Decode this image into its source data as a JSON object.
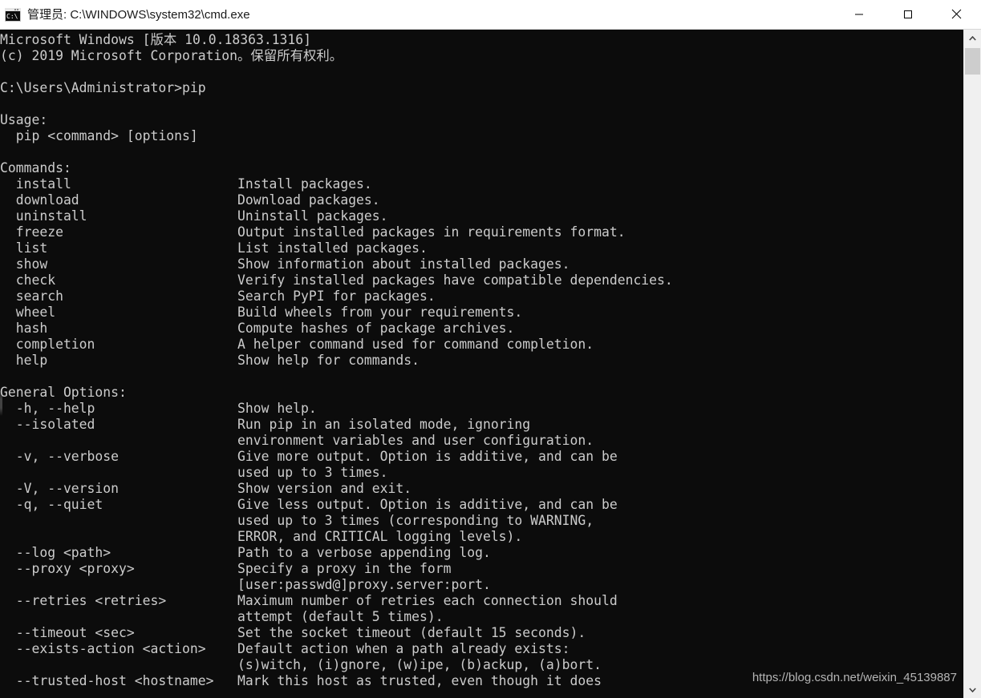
{
  "window": {
    "title": "管理员: C:\\WINDOWS\\system32\\cmd.exe",
    "icon": "cmd-icon",
    "controls": {
      "minimize": "minimize-button",
      "maximize": "maximize-button",
      "close": "close-button"
    },
    "colors": {
      "titlebar_bg": "#ffffff",
      "titlebar_fg": "#1a1a1a",
      "console_bg": "#0c0c0c",
      "console_fg": "#cccccc",
      "scrollbar_track": "#f0f0f0",
      "scrollbar_thumb": "#cdcdcd"
    }
  },
  "console": {
    "banner": [
      "Microsoft Windows [版本 10.0.18363.1316]",
      "(c) 2019 Microsoft Corporation。保留所有权利。"
    ],
    "prompt": "C:\\Users\\Administrator>",
    "command": "pip",
    "usage_header": "Usage:",
    "usage_line": "pip <command> [options]",
    "commands_header": "Commands:",
    "commands": [
      {
        "name": "install",
        "desc": "Install packages."
      },
      {
        "name": "download",
        "desc": "Download packages."
      },
      {
        "name": "uninstall",
        "desc": "Uninstall packages."
      },
      {
        "name": "freeze",
        "desc": "Output installed packages in requirements format."
      },
      {
        "name": "list",
        "desc": "List installed packages."
      },
      {
        "name": "show",
        "desc": "Show information about installed packages."
      },
      {
        "name": "check",
        "desc": "Verify installed packages have compatible dependencies."
      },
      {
        "name": "search",
        "desc": "Search PyPI for packages."
      },
      {
        "name": "wheel",
        "desc": "Build wheels from your requirements."
      },
      {
        "name": "hash",
        "desc": "Compute hashes of package archives."
      },
      {
        "name": "completion",
        "desc": "A helper command used for command completion."
      },
      {
        "name": "help",
        "desc": "Show help for commands."
      }
    ],
    "general_options_header": "General Options:",
    "general_options": [
      {
        "name": "-h, --help",
        "desc": [
          "Show help."
        ]
      },
      {
        "name": "--isolated",
        "desc": [
          "Run pip in an isolated mode, ignoring",
          "environment variables and user configuration."
        ]
      },
      {
        "name": "-v, --verbose",
        "desc": [
          "Give more output. Option is additive, and can be",
          "used up to 3 times."
        ]
      },
      {
        "name": "-V, --version",
        "desc": [
          "Show version and exit."
        ]
      },
      {
        "name": "-q, --quiet",
        "desc": [
          "Give less output. Option is additive, and can be",
          "used up to 3 times (corresponding to WARNING,",
          "ERROR, and CRITICAL logging levels)."
        ]
      },
      {
        "name": "--log <path>",
        "desc": [
          "Path to a verbose appending log."
        ]
      },
      {
        "name": "--proxy <proxy>",
        "desc": [
          "Specify a proxy in the form",
          "[user:passwd@]proxy.server:port."
        ]
      },
      {
        "name": "--retries <retries>",
        "desc": [
          "Maximum number of retries each connection should",
          "attempt (default 5 times)."
        ]
      },
      {
        "name": "--timeout <sec>",
        "desc": [
          "Set the socket timeout (default 15 seconds)."
        ]
      },
      {
        "name": "--exists-action <action>",
        "desc": [
          "Default action when a path already exists:",
          "(s)witch, (i)gnore, (w)ipe, (b)ackup, (a)bort."
        ]
      },
      {
        "name": "--trusted-host <hostname>",
        "desc": [
          "Mark this host as trusted, even though it does"
        ]
      }
    ],
    "desc_column": 30
  },
  "watermark": "https://blog.csdn.net/weixin_45139887"
}
